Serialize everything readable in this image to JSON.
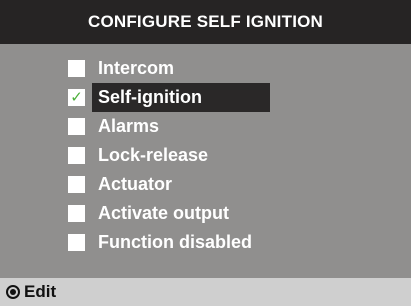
{
  "title": "CONFIGURE SELF IGNITION",
  "options": [
    {
      "label": "Intercom",
      "checked": false
    },
    {
      "label": "Self-ignition",
      "checked": true
    },
    {
      "label": "Alarms",
      "checked": false
    },
    {
      "label": "Lock-release",
      "checked": false
    },
    {
      "label": "Actuator",
      "checked": false
    },
    {
      "label": "Activate output",
      "checked": false
    },
    {
      "label": "Function disabled",
      "checked": false
    }
  ],
  "check_mark": "✓",
  "footer": {
    "edit_label": "Edit",
    "icon": "radio-button-icon"
  },
  "colors": {
    "title_bg": "#262424",
    "panel_bg": "#908f8e",
    "footer_bg": "#cfcfcf",
    "selected_bg": "#2a2828",
    "check_color": "#4caf3a"
  }
}
